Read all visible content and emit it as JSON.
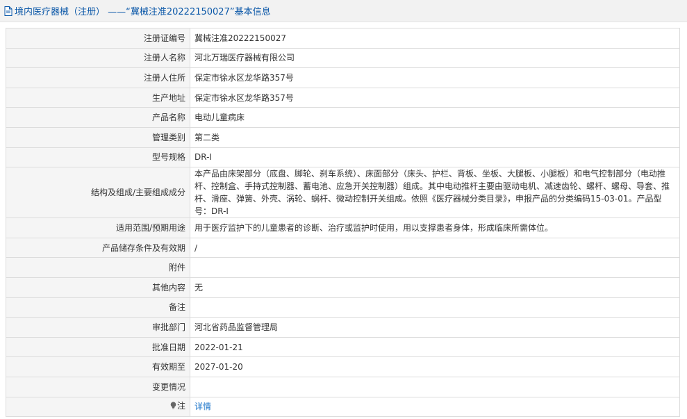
{
  "header": {
    "title": "境内医疗器械（注册） ——“冀械注准20222150027”基本信息"
  },
  "rows": [
    {
      "label": "注册证编号",
      "value": "冀械注准20222150027"
    },
    {
      "label": "注册人名称",
      "value": "河北万瑞医疗器械有限公司"
    },
    {
      "label": "注册人住所",
      "value": "保定市徐水区龙华路357号"
    },
    {
      "label": "生产地址",
      "value": "保定市徐水区龙华路357号"
    },
    {
      "label": "产品名称",
      "value": "电动儿童病床"
    },
    {
      "label": "管理类别",
      "value": "第二类"
    },
    {
      "label": "型号规格",
      "value": "DR-I"
    },
    {
      "label": "结构及组成/主要组成成分",
      "value": "本产品由床架部分（底盘、脚轮、刹车系统）、床面部分（床头、护栏、背板、坐板、大腿板、小腿板）和电气控制部分（电动推杆、控制盒、手持式控制器、蓄电池、应急开关控制器）组成。其中电动推杆主要由驱动电机、减速齿轮、螺杆、螺母、导套、推杆、滑座、弹簧、外壳、涡轮、蜗杆、微动控制开关组成。依照《医疗器械分类目录》，申报产品的分类编码15-03-01。产品型号：DR-I"
    },
    {
      "label": "适用范围/预期用途",
      "value": "用于医疗监护下的儿童患者的诊断、治疗或监护时使用，用以支撑患者身体，形成临床所需体位。"
    },
    {
      "label": "产品储存条件及有效期",
      "value": "/"
    },
    {
      "label": "附件",
      "value": ""
    },
    {
      "label": "其他内容",
      "value": "无"
    },
    {
      "label": "备注",
      "value": ""
    },
    {
      "label": "审批部门",
      "value": "河北省药品监督管理局"
    },
    {
      "label": "批准日期",
      "value": "2022-01-21"
    },
    {
      "label": "有效期至",
      "value": "2027-01-20"
    },
    {
      "label": "变更情况",
      "value": ""
    }
  ],
  "note": {
    "label": "注",
    "link": "详情",
    "icon": "lightbulb-icon"
  },
  "colors": {
    "header_text": "#0a57a8",
    "link": "#1a73c9",
    "label_bg": "#f5f5f5",
    "border": "#dcdcdc"
  }
}
